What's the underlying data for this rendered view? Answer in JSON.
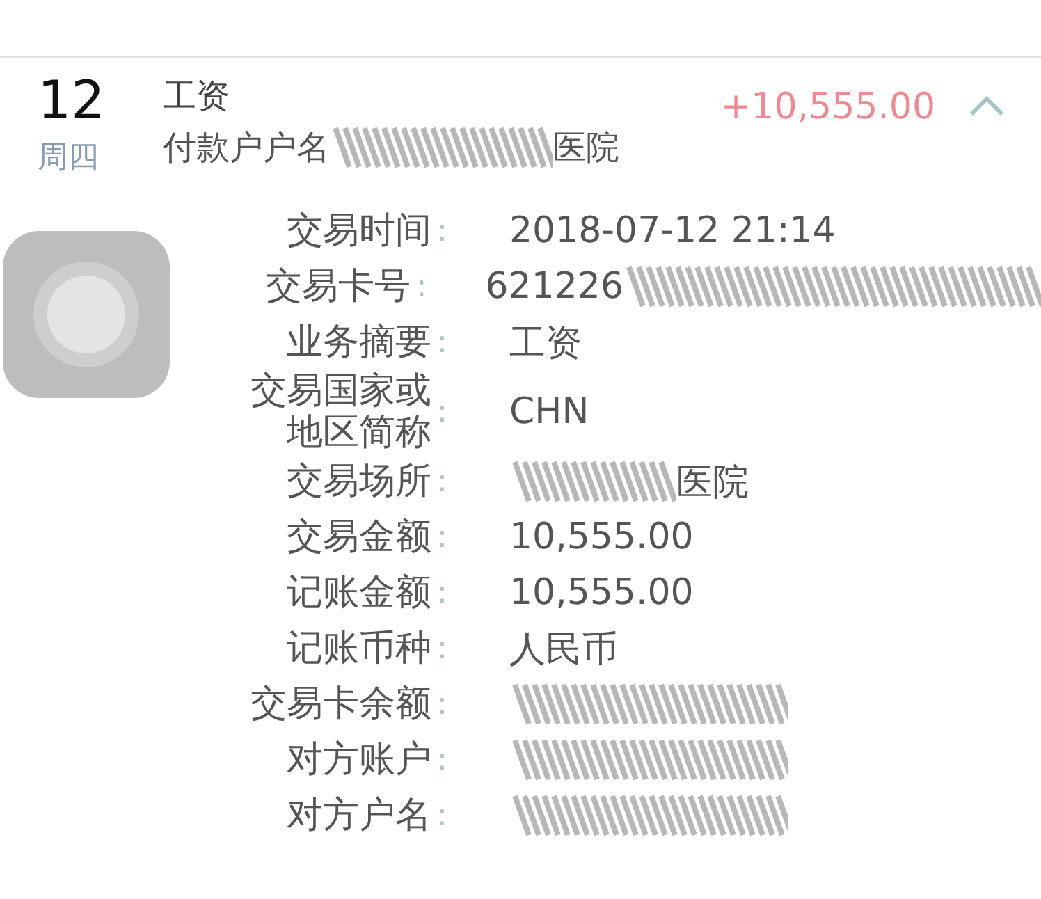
{
  "transaction": {
    "day": "12",
    "weekday": "周四",
    "title": "工资",
    "subtitle": "付款户户名",
    "subtitle_end": "医院",
    "amount": "+10,555.00",
    "expanded": true,
    "details": [
      {
        "label": "交易时间",
        "separator": ":",
        "value": "2018-07-12 21:14",
        "scribble_before": false,
        "scribble_after": false
      },
      {
        "label": "交易卡号",
        "separator": ":",
        "value": "621226",
        "scribble_before": false,
        "scribble_after": true
      },
      {
        "label": "业务摘要",
        "separator": ":",
        "value": "工资",
        "scribble_before": false,
        "scribble_after": false
      },
      {
        "label": "交易国家或地区简称",
        "separator": ":",
        "value": "CHN",
        "scribble_before": false,
        "scribble_after": false
      },
      {
        "label": "交易场所",
        "separator": ":",
        "value": "医院",
        "scribble_before": true,
        "scribble_after": false
      },
      {
        "label": "交易金额",
        "separator": ":",
        "value": "10,555.00",
        "scribble_before": false,
        "scribble_after": false
      },
      {
        "label": "记账金额",
        "separator": ":",
        "value": "10,555.00",
        "scribble_before": false,
        "scribble_after": false
      },
      {
        "label": "记账币种",
        "separator": ":",
        "value": "人民币",
        "scribble_before": false,
        "scribble_after": false
      },
      {
        "label": "交易卡余额",
        "separator": ":",
        "scribble_before": true,
        "scribble_after": false
      },
      {
        "label": "对方账户",
        "separator": ":",
        "scribble_before": true,
        "scribble_after": false
      },
      {
        "label": "对方户名",
        "separator": ":",
        "scribble_before": true,
        "scribble_after": false
      }
    ]
  }
}
